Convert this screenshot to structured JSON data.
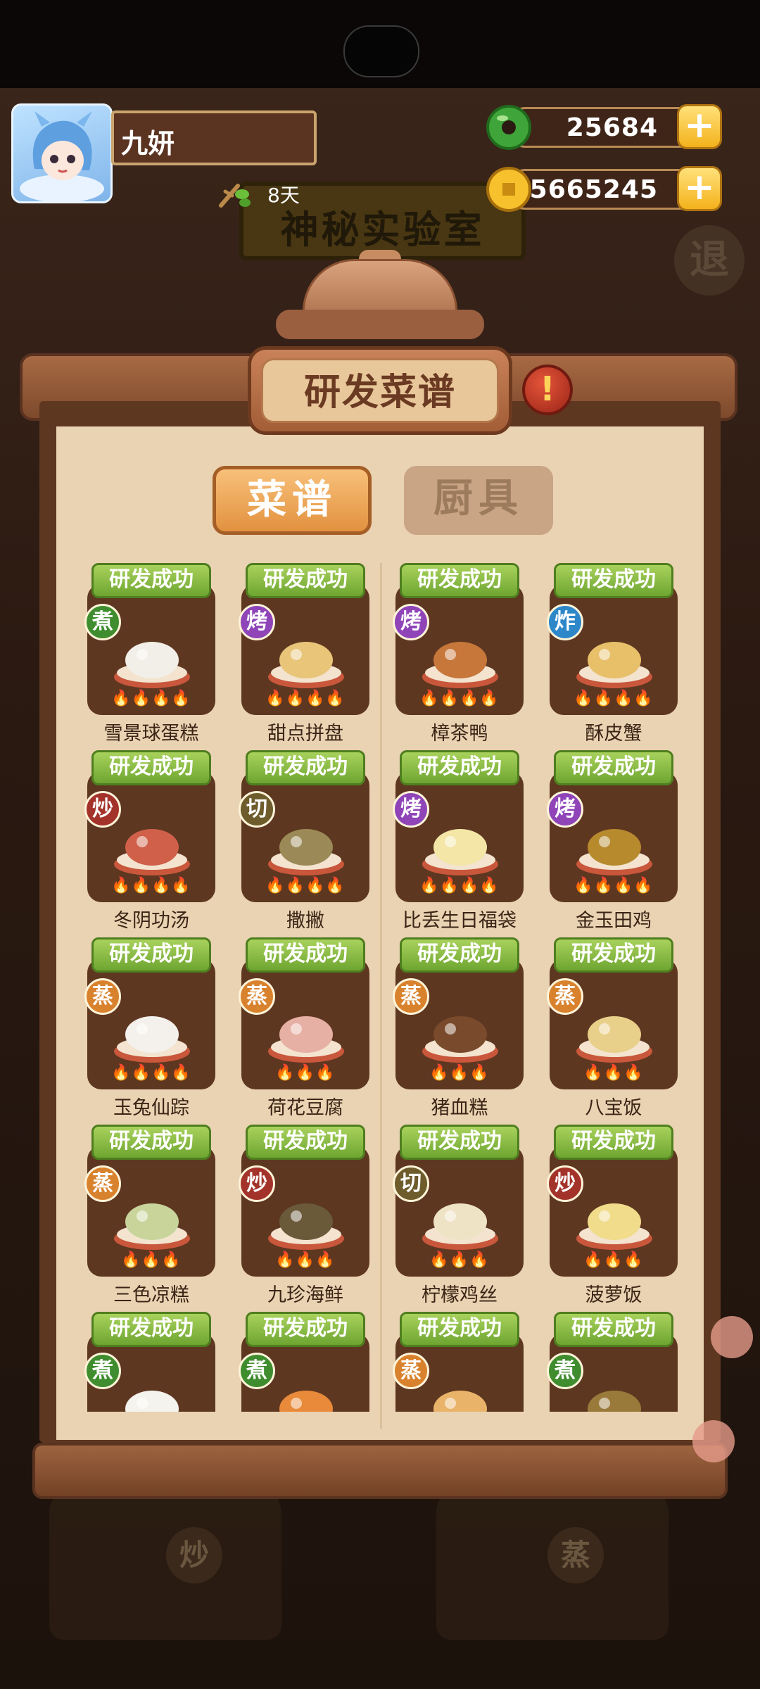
{
  "header": {
    "player_name": "九妍",
    "days_label": "8天",
    "jade_amount": "25684",
    "coin_amount": "45665245",
    "plus_symbol": "+"
  },
  "background": {
    "lab_sign": "神秘实验室",
    "exit_label": "退",
    "stove_left_label": "炒",
    "stove_right_label": "蒸"
  },
  "panel": {
    "title": "研发菜谱",
    "info_symbol": "!",
    "tabs": [
      {
        "label": "菜谱",
        "active": true
      },
      {
        "label": "厨具",
        "active": false
      }
    ]
  },
  "recipes": [
    {
      "status": "研发成功",
      "method": "煮",
      "method_color": "green",
      "name": "雪景球蛋糕",
      "flames": 4
    },
    {
      "status": "研发成功",
      "method": "烤",
      "method_color": "purple",
      "name": "甜点拼盘",
      "flames": 4
    },
    {
      "status": "研发成功",
      "method": "烤",
      "method_color": "purple",
      "name": "樟茶鸭",
      "flames": 4
    },
    {
      "status": "研发成功",
      "method": "炸",
      "method_color": "blue",
      "name": "酥皮蟹",
      "flames": 4
    },
    {
      "status": "研发成功",
      "method": "炒",
      "method_color": "red",
      "name": "冬阴功汤",
      "flames": 4
    },
    {
      "status": "研发成功",
      "method": "切",
      "method_color": "olive",
      "name": "撒撇",
      "flames": 4
    },
    {
      "status": "研发成功",
      "method": "烤",
      "method_color": "purple",
      "name": "比丢生日福袋",
      "flames": 4
    },
    {
      "status": "研发成功",
      "method": "烤",
      "method_color": "purple",
      "name": "金玉田鸡",
      "flames": 4
    },
    {
      "status": "研发成功",
      "method": "蒸",
      "method_color": "orange",
      "name": "玉兔仙踪",
      "flames": 4
    },
    {
      "status": "研发成功",
      "method": "蒸",
      "method_color": "orange",
      "name": "荷花豆腐",
      "flames": 3
    },
    {
      "status": "研发成功",
      "method": "蒸",
      "method_color": "orange",
      "name": "猪血糕",
      "flames": 3
    },
    {
      "status": "研发成功",
      "method": "蒸",
      "method_color": "orange",
      "name": "八宝饭",
      "flames": 3
    },
    {
      "status": "研发成功",
      "method": "蒸",
      "method_color": "orange",
      "name": "三色凉糕",
      "flames": 3
    },
    {
      "status": "研发成功",
      "method": "炒",
      "method_color": "red",
      "name": "九珍海鲜",
      "flames": 3
    },
    {
      "status": "研发成功",
      "method": "切",
      "method_color": "olive",
      "name": "柠檬鸡丝",
      "flames": 3
    },
    {
      "status": "研发成功",
      "method": "炒",
      "method_color": "red",
      "name": "菠萝饭",
      "flames": 3
    },
    {
      "status": "研发成功",
      "method": "煮",
      "method_color": "green",
      "name": "",
      "flames": 0
    },
    {
      "status": "研发成功",
      "method": "煮",
      "method_color": "green",
      "name": "",
      "flames": 0
    },
    {
      "status": "研发成功",
      "method": "蒸",
      "method_color": "orange",
      "name": "",
      "flames": 0
    },
    {
      "status": "研发成功",
      "method": "煮",
      "method_color": "green",
      "name": "",
      "flames": 0
    }
  ],
  "colors": {
    "badge_green": "#8cc047",
    "card_brown": "#5e3721",
    "paper": "#e9d3b2",
    "tab_active": "#f0a85a"
  }
}
